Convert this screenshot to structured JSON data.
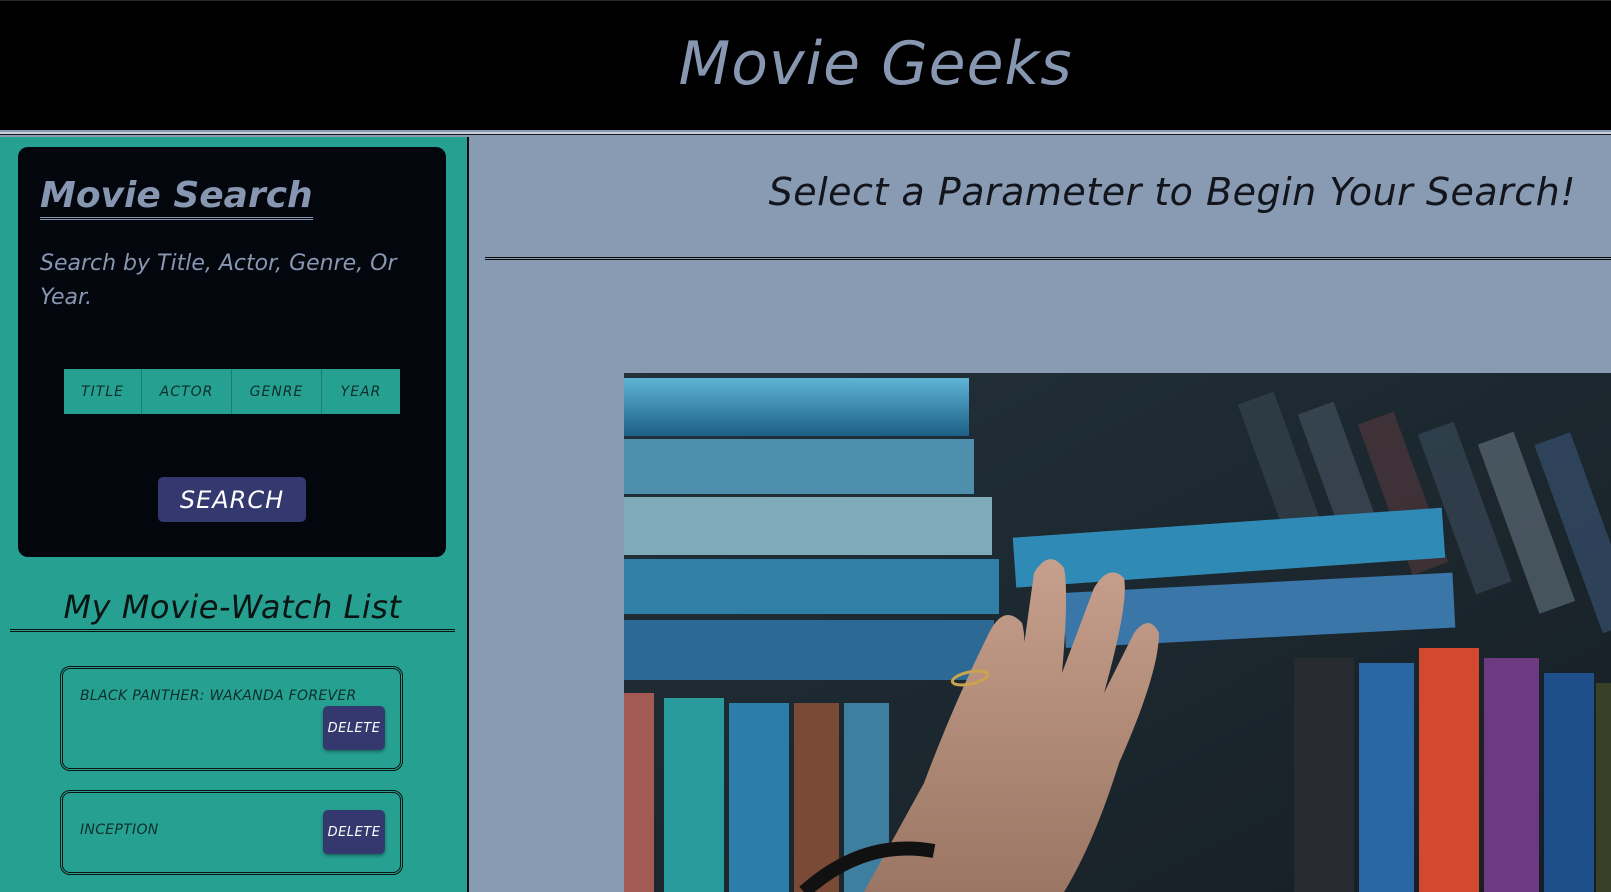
{
  "header": {
    "title": "Movie Geeks"
  },
  "search_panel": {
    "title": "Movie Search",
    "description": "Search by Title, Actor, Genre, Or Year.",
    "parameters": [
      "TITLE",
      "ACTOR",
      "GENRE",
      "YEAR"
    ],
    "search_label": "SEARCH"
  },
  "watch_list": {
    "title": "My Movie-Watch List",
    "items": [
      {
        "name": "BLACK PANTHER: WAKANDA FOREVER",
        "delete_label": "DELETE"
      },
      {
        "name": "INCEPTION",
        "delete_label": "DELETE"
      }
    ]
  },
  "main": {
    "heading": "Select a Parameter to Begin Your Search!",
    "hero_image": "hand-reaching-for-vhs-tapes"
  },
  "colors": {
    "header_bg": "#000000",
    "header_text": "#8796b1",
    "sidebar_bg": "#26a091",
    "card_bg": "#03060c",
    "button_bg": "#33386f",
    "main_bg": "#899ab3"
  }
}
